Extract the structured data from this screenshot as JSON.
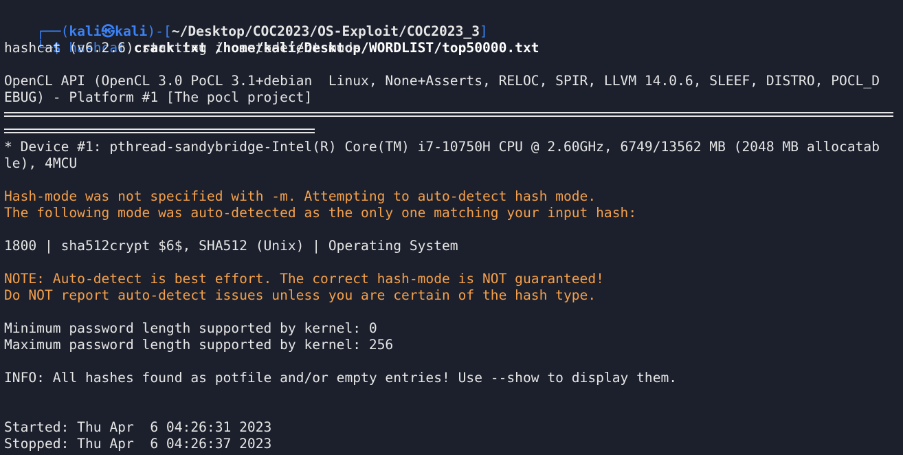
{
  "prompt": {
    "frame_top": "┌──(",
    "user": "kali㉿kali",
    "frame_mid": ")-[",
    "path": "~/Desktop/COC2023/OS-Exploit/COC2023_3",
    "frame_end": "]",
    "frame_bottom": "└─",
    "dollar": "$ ",
    "command": "hashcat",
    "args": " crack.txt /home/kali/Desktop/WORDLIST/top50000.txt"
  },
  "output": {
    "l1": "hashcat (v6.2.6) starting in autodetect mode",
    "l2": "OpenCL API (OpenCL 3.0 PoCL 3.1+debian  Linux, None+Asserts, RELOC, SPIR, LLVM 14.0.6, SLEEF, DISTRO, POCL_D",
    "l3": "EBUG) - Platform #1 [The pocl project]",
    "l4": "* Device #1: pthread-sandybridge-Intel(R) Core(TM) i7-10750H CPU @ 2.60GHz, 6749/13562 MB (2048 MB allocatab",
    "l5": "le), 4MCU",
    "l6": "Hash-mode was not specified with -m. Attempting to auto-detect hash mode.",
    "l7": "The following mode was auto-detected as the only one matching your input hash:",
    "l8": "1800 | sha512crypt $6$, SHA512 (Unix) | Operating System",
    "l9": "NOTE: Auto-detect is best effort. The correct hash-mode is NOT guaranteed!",
    "l10": "Do NOT report auto-detect issues unless you are certain of the hash type.",
    "l11": "Minimum password length supported by kernel: 0",
    "l12": "Maximum password length supported by kernel: 256",
    "l13": "INFO: All hashes found as potfile and/or empty entries! Use --show to display them.",
    "l14": "Started: Thu Apr  6 04:26:31 2023",
    "l15": "Stopped: Thu Apr  6 04:26:37 2023"
  },
  "colors": {
    "background": "#1c202c",
    "prompt_blue": "#3b82f6",
    "warning_orange": "#f5a04a",
    "text": "#e6e6e6"
  }
}
